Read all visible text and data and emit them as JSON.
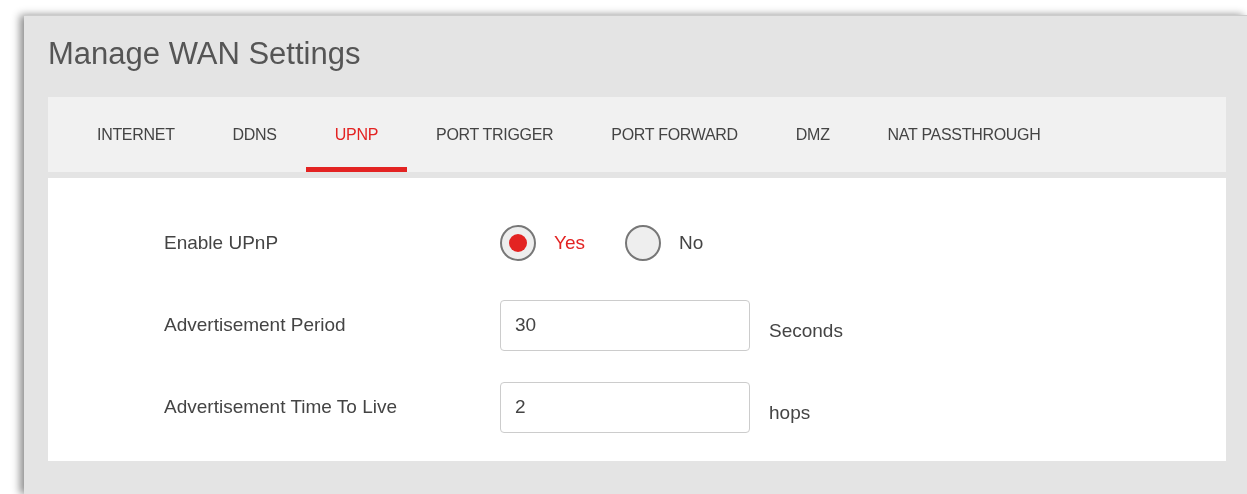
{
  "title": "Manage WAN Settings",
  "tabs": [
    {
      "label": "INTERNET",
      "selected": false
    },
    {
      "label": "DDNS",
      "selected": false
    },
    {
      "label": "UPNP",
      "selected": true
    },
    {
      "label": "PORT TRIGGER",
      "selected": false
    },
    {
      "label": "PORT FORWARD",
      "selected": false
    },
    {
      "label": "DMZ",
      "selected": false
    },
    {
      "label": "NAT PASSTHROUGH",
      "selected": false
    }
  ],
  "fields": [
    {
      "kind": "radio",
      "label": "Enable UPnP",
      "options": [
        {
          "label": "Yes",
          "selected": true
        },
        {
          "label": "No",
          "selected": false
        }
      ]
    },
    {
      "kind": "text",
      "label": "Advertisement Period",
      "value": "30",
      "unit": "Seconds"
    },
    {
      "kind": "text",
      "label": "Advertisement Time To Live",
      "value": "2",
      "unit": "hops"
    }
  ]
}
